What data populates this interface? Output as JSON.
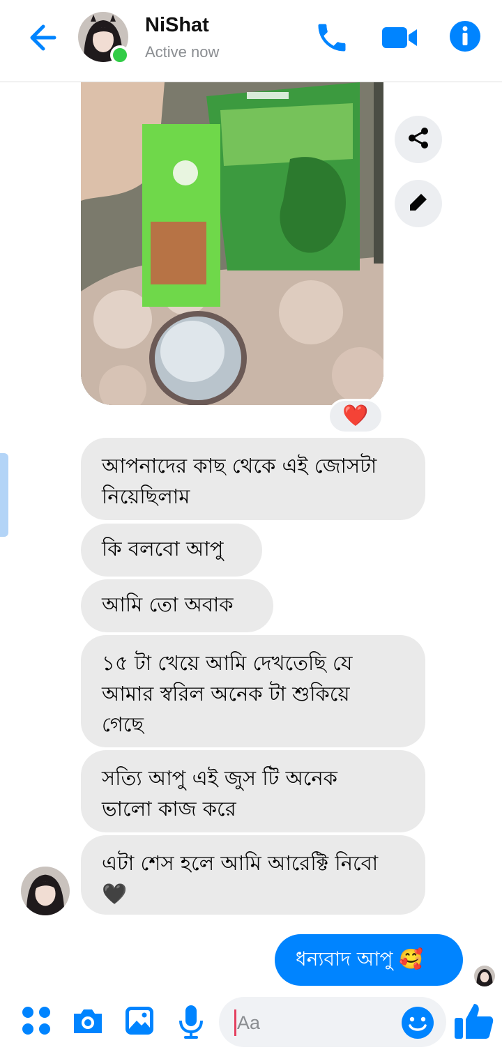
{
  "header": {
    "name": "NiShat",
    "status": "Active now"
  },
  "colors": {
    "accent": "#0084ff",
    "incoming_bubble": "#eaeaea",
    "online": "#31cc46"
  },
  "messages": {
    "incoming": [
      "আপনাদের কাছ থেকে এই জোসটা\nনিয়েছিলাম",
      "কি বলবো আপু",
      "আমি তো অবাক",
      "১৫ টা খেয়ে আমি দেখতেছি যে\nআমার স্বরিল অনেক টা শুকিয়ে\nগেছে",
      "সত্যি আপু এই জুস টি অনেক\nভালো কাজ করে",
      "এটা শেস হলে আমি আরেক্টি নিবো\n🖤"
    ],
    "outgoing": "ধন্যবাদ আপু 🥰"
  },
  "reaction": "❤️",
  "composer": {
    "placeholder": "Aa"
  },
  "icons": [
    "back-arrow-icon",
    "phone-icon",
    "video-camera-icon",
    "info-icon",
    "share-icon",
    "pencil-icon",
    "apps-icon",
    "camera-icon",
    "gallery-icon",
    "microphone-icon",
    "emoji-icon",
    "thumbs-up-icon"
  ]
}
